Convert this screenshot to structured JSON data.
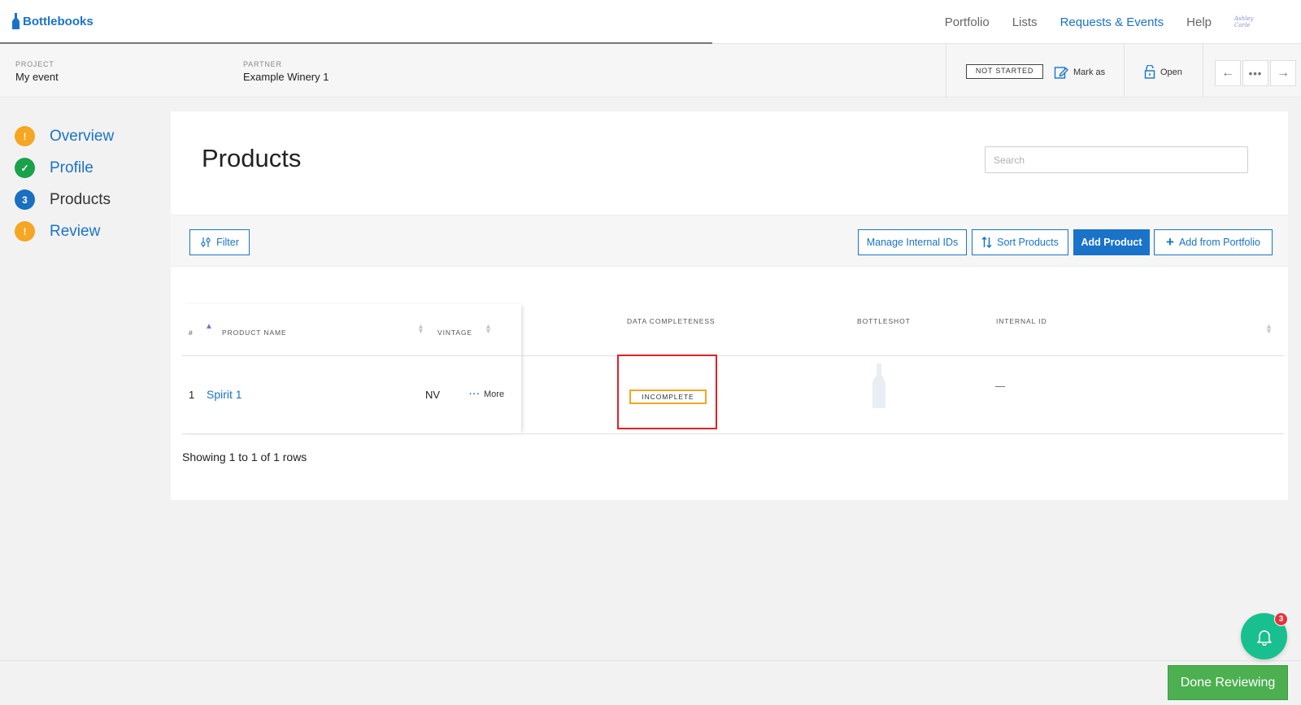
{
  "nav": {
    "brand": "Bottlebooks",
    "links": [
      "Portfolio",
      "Lists",
      "Requests & Events",
      "Help"
    ],
    "active_link": "Requests & Events",
    "avatar_text": "Ashley Carle"
  },
  "project_bar": {
    "project_label": "PROJECT",
    "project_value": "My event",
    "partner_label": "PARTNER",
    "partner_value": "Example Winery 1",
    "status": "NOT STARTED",
    "mark_as": "Mark as",
    "open": "Open"
  },
  "steps": [
    {
      "label": "Overview",
      "state": "warning",
      "marker": "!"
    },
    {
      "label": "Profile",
      "state": "done",
      "marker": "✓"
    },
    {
      "label": "Products",
      "state": "current",
      "marker": "3"
    },
    {
      "label": "Review",
      "state": "warning",
      "marker": "!"
    }
  ],
  "main": {
    "title": "Products",
    "search_placeholder": "Search",
    "toolbar": {
      "filter": "Filter",
      "manage_ids": "Manage Internal IDs",
      "sort_products": "Sort Products",
      "add_product": "Add Product",
      "add_from_portfolio": "Add from Portfolio"
    },
    "table": {
      "headers": {
        "num": "#",
        "product_name": "PRODUCT NAME",
        "vintage": "VINTAGE",
        "data_completeness": "DATA COMPLETENESS",
        "bottleshot": "BOTTLESHOT",
        "internal_id": "INTERNAL ID"
      },
      "rows": [
        {
          "num": "1",
          "product_name": "Spirit 1",
          "vintage": "NV",
          "more": "More",
          "completeness": "INCOMPLETE",
          "internal_id": "—"
        }
      ]
    },
    "row_count_text": "Showing 1 to 1 of 1 rows"
  },
  "footer": {
    "done_label": "Done Reviewing",
    "notification_count": "3"
  },
  "colors": {
    "accent": "#1a73c9",
    "warning": "#f5a623",
    "success": "#1aa24a",
    "done_button": "#4caf50",
    "bell": "#19c08f",
    "highlight": "#e41e26"
  }
}
